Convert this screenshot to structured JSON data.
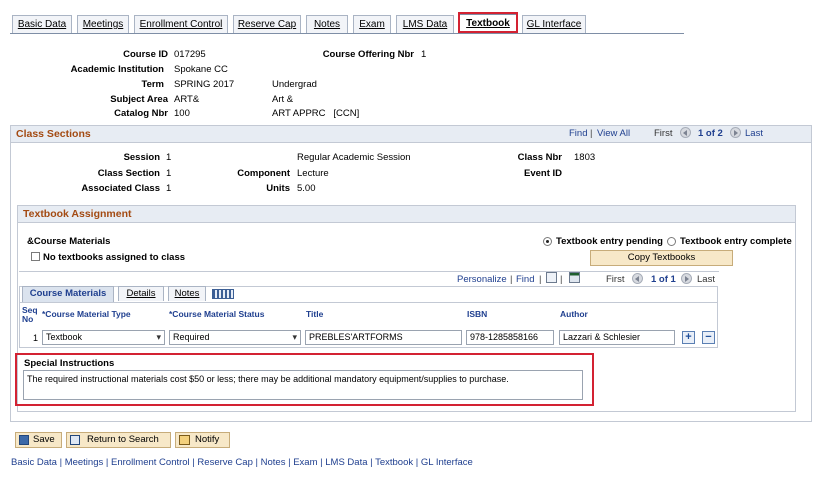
{
  "tabs": [
    {
      "label": "Basic Data",
      "active": false
    },
    {
      "label": "Meetings",
      "active": false
    },
    {
      "label": "Enrollment Control",
      "active": false
    },
    {
      "label": "Reserve Cap",
      "active": false
    },
    {
      "label": "Notes",
      "active": false
    },
    {
      "label": "Exam",
      "active": false
    },
    {
      "label": "LMS Data",
      "active": false
    },
    {
      "label": "Textbook",
      "active": true
    },
    {
      "label": "GL Interface",
      "active": false
    }
  ],
  "header": {
    "course_id_label": "Course ID",
    "course_id": "017295",
    "offering_label": "Course Offering Nbr",
    "offering": "1",
    "institution_label": "Academic Institution",
    "institution": "Spokane CC",
    "term_label": "Term",
    "term": "SPRING 2017",
    "term_career": "Undergrad",
    "subject_label": "Subject Area",
    "subject": "ART&",
    "subject_desc": "Art &",
    "catalog_label": "Catalog Nbr",
    "catalog": "100",
    "catalog_desc": "ART APPRC   [CCN]"
  },
  "class_sections": {
    "title": "Class Sections",
    "find": "Find",
    "view_all": "View All",
    "first": "First",
    "pager": "1 of 2",
    "last": "Last",
    "session_label": "Session",
    "session": "1",
    "session_desc": "Regular Academic Session",
    "class_nbr_label": "Class Nbr",
    "class_nbr": "1803",
    "class_section_label": "Class Section",
    "class_section": "1",
    "component_label": "Component",
    "component": "Lecture",
    "event_id_label": "Event ID",
    "assoc_label": "Associated Class",
    "assoc": "1",
    "units_label": "Units",
    "units": "5.00"
  },
  "textbook": {
    "title": "Textbook Assignment",
    "course_materials_label": "&Course Materials",
    "no_textbooks_label": "No textbooks assigned to class",
    "radio_pending": "Textbook entry pending",
    "radio_complete": "Textbook entry complete",
    "copy_button": "Copy Textbooks"
  },
  "grid": {
    "personalize": "Personalize",
    "find": "Find",
    "first": "First",
    "pager": "1 of 1",
    "last": "Last",
    "subtabs": [
      "Course Materials",
      "Details",
      "Notes"
    ],
    "columns": {
      "seq": "Seq No",
      "type": "*Course Material Type",
      "status": "*Course Material Status",
      "title": "Title",
      "isbn": "ISBN",
      "author": "Author"
    },
    "row": {
      "seq": "1",
      "type": "Textbook",
      "status": "Required",
      "title": "PREBLES'ARTFORMS",
      "isbn": "978-1285858166",
      "author": "Lazzari & Schlesier"
    }
  },
  "special": {
    "label": "Special Instructions",
    "text": "The required instructional materials cost $50 or less; there may be additional mandatory equipment/supplies to purchase."
  },
  "buttons": {
    "save": "Save",
    "return_to_search": "Return to Search",
    "notify": "Notify"
  },
  "footer_links": [
    "Basic Data",
    "Meetings",
    "Enrollment Control",
    "Reserve Cap",
    "Notes",
    "Exam",
    "LMS Data",
    "Textbook",
    "GL Interface"
  ],
  "colors": {
    "section_title": "#a34a12",
    "link": "#1f3f8f",
    "highlight": "#d32232",
    "button_bg": "#f7e8c8"
  }
}
